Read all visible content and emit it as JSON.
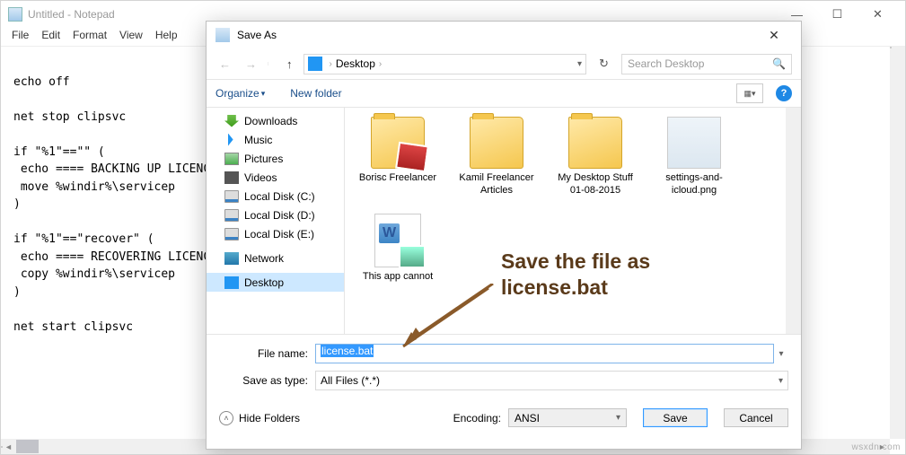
{
  "notepad": {
    "title": "Untitled - Notepad",
    "menu": [
      "File",
      "Edit",
      "Format",
      "View",
      "Help"
    ],
    "window_controls": {
      "min": "—",
      "max": "☐",
      "close": "✕"
    },
    "content": "\necho off\n\nnet stop clipsvc\n\nif \"%1\"==\"\" (\n echo ==== BACKING UP LICENCE FILES to %windir%\\serviceprofiles\\localservice                    files\\locals\n move %windir%\\servicep\n)\n\nif \"%1\"==\"recover\" (\n echo ==== RECOVERING LICENCE %windir%\\serviceprofiles\\localsystem            files\\locals\n copy %windir%\\servicep\n)\n\nnet start clipsvc"
  },
  "saveas": {
    "title": "Save As",
    "close": "✕",
    "nav": {
      "back": "←",
      "forward": "→",
      "up": "↑"
    },
    "path": {
      "root_icon": "desktop",
      "location": "Desktop",
      "chev": "›",
      "drop": "▾"
    },
    "refresh": "↻",
    "search": {
      "placeholder": "Search Desktop",
      "icon": "🔍"
    },
    "toolbar": {
      "organize": "Organize",
      "drop": "▾",
      "newfolder": "New folder",
      "view_drop": "▾",
      "help": "?"
    },
    "tree": [
      {
        "icon": "ic-dl",
        "label": "Downloads"
      },
      {
        "icon": "ic-mu",
        "label": "Music"
      },
      {
        "icon": "ic-pic",
        "label": "Pictures"
      },
      {
        "icon": "ic-vid",
        "label": "Videos"
      },
      {
        "icon": "ic-disk",
        "label": "Local Disk (C:)"
      },
      {
        "icon": "ic-disk",
        "label": "Local Disk (D:)"
      },
      {
        "icon": "ic-disk",
        "label": "Local Disk (E:)"
      },
      {
        "icon": "ic-net",
        "label": "Network"
      },
      {
        "icon": "ic-desk",
        "label": "Desktop",
        "selected": true
      }
    ],
    "files": [
      {
        "type": "folder_photo",
        "label": "Borisc Freelancer"
      },
      {
        "type": "folder",
        "label": "Kamil Freelancer Articles"
      },
      {
        "type": "folder",
        "label": "My Desktop Stuff 01-08-2015"
      },
      {
        "type": "png",
        "label": "settings-and-icloud.png"
      },
      {
        "type": "word",
        "label": "This app cannot"
      }
    ],
    "filename_label": "File name:",
    "filename_value": "license.bat",
    "saveastype_label": "Save as type:",
    "saveastype_value": "All Files  (*.*)",
    "hide_folders": "Hide Folders",
    "encoding_label": "Encoding:",
    "encoding_value": "ANSI",
    "save_btn": "Save",
    "cancel_btn": "Cancel"
  },
  "annotation": {
    "line1": "Save the file as",
    "line2": "license.bat"
  },
  "watermark": "wsxdn.com"
}
